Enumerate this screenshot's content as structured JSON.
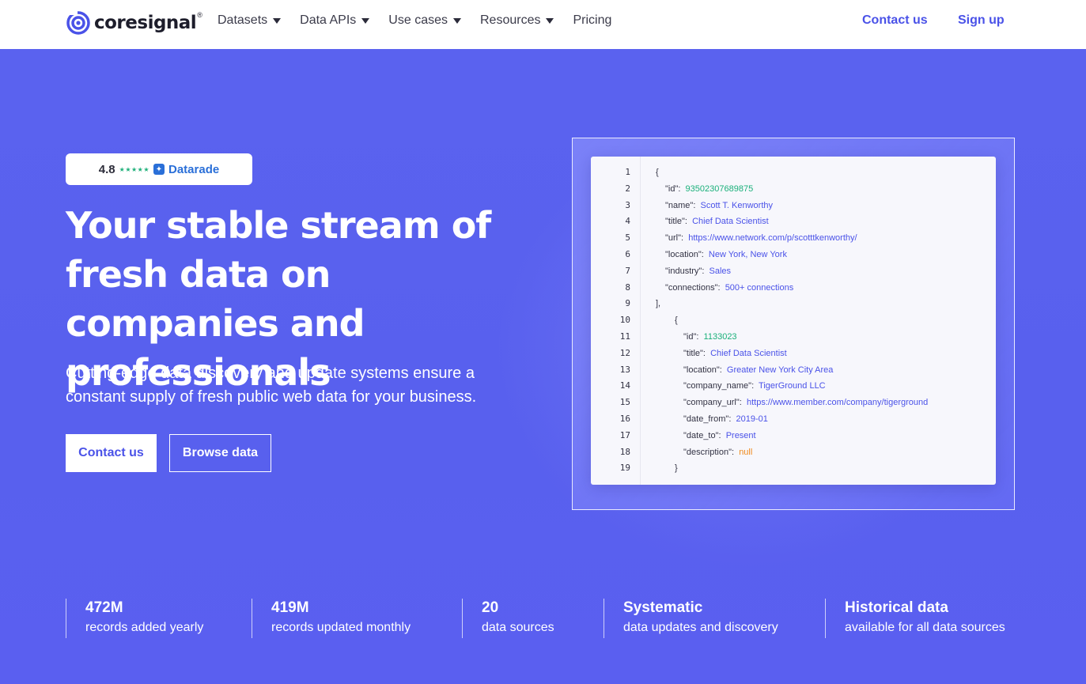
{
  "nav": {
    "brand": "coresignal",
    "brand_mark": "®",
    "menu": [
      {
        "label": "Datasets",
        "has_dropdown": true
      },
      {
        "label": "Data APIs",
        "has_dropdown": true
      },
      {
        "label": "Use cases",
        "has_dropdown": true
      },
      {
        "label": "Resources",
        "has_dropdown": true
      },
      {
        "label": "Pricing",
        "has_dropdown": false
      }
    ],
    "contact_label": "Contact us",
    "signup_label": "Sign up"
  },
  "hero": {
    "rating": {
      "score": "4.8",
      "stars": "★★★★★",
      "provider": "Datarade",
      "provider_icon": "datarade-icon"
    },
    "headline": "Your stable stream of fresh data on companies and professionals",
    "subtext": "Cutting-edge data discovery and update systems ensure a constant supply of fresh public web data for your business.",
    "primary_button": "Contact us",
    "secondary_button": "Browse data"
  },
  "code_sample": {
    "lines": [
      {
        "n": "1",
        "indent": 0,
        "text": "{"
      },
      {
        "n": "2",
        "indent": 1,
        "key": "\"id\":",
        "value": "93502307689875",
        "type": "num"
      },
      {
        "n": "3",
        "indent": 1,
        "key": "\"name\":",
        "value": "Scott T. Kenworthy",
        "type": "str"
      },
      {
        "n": "4",
        "indent": 1,
        "key": "\"title\":",
        "value": "Chief Data Scientist",
        "type": "str"
      },
      {
        "n": "5",
        "indent": 1,
        "key": "\"url\":",
        "value": "https://www.network.com/p/scotttkenworthy/",
        "type": "str"
      },
      {
        "n": "6",
        "indent": 1,
        "key": "\"location\":",
        "value": "New York, New York",
        "type": "str"
      },
      {
        "n": "7",
        "indent": 1,
        "key": "\"industry\":",
        "value": "Sales",
        "type": "str"
      },
      {
        "n": "8",
        "indent": 1,
        "key": "\"connections\":",
        "value": "500+ connections",
        "type": "str"
      },
      {
        "n": "9",
        "indent": 0,
        "text": "],"
      },
      {
        "n": "10",
        "indent": 2,
        "text": "{"
      },
      {
        "n": "11",
        "indent": 3,
        "key": "\"id\":",
        "value": "1133023",
        "type": "num"
      },
      {
        "n": "12",
        "indent": 3,
        "key": "\"title\":",
        "value": "Chief Data Scientist",
        "type": "str"
      },
      {
        "n": "13",
        "indent": 3,
        "key": "\"location\":",
        "value": "Greater New York City Area",
        "type": "str"
      },
      {
        "n": "14",
        "indent": 3,
        "key": "\"company_name\":",
        "value": "TigerGround LLC",
        "type": "str"
      },
      {
        "n": "15",
        "indent": 3,
        "key": "\"company_url\":",
        "value": "https://www.member.com/company/tigerground",
        "type": "str"
      },
      {
        "n": "16",
        "indent": 3,
        "key": "\"date_from\":",
        "value": "2019-01",
        "type": "str"
      },
      {
        "n": "17",
        "indent": 3,
        "key": "\"date_to\":",
        "value": "Present",
        "type": "str"
      },
      {
        "n": "18",
        "indent": 3,
        "key": "\"description\":",
        "value": "null",
        "type": "null"
      },
      {
        "n": "19",
        "indent": 2,
        "text": "}"
      }
    ]
  },
  "stats": [
    {
      "value": "472M",
      "label": "records added yearly"
    },
    {
      "value": "419M",
      "label": "records updated monthly"
    },
    {
      "value": "20",
      "label": "data sources"
    },
    {
      "value": "Systematic",
      "label": "data updates and discovery"
    },
    {
      "value": "Historical data",
      "label": "available for all data sources"
    }
  ],
  "colors": {
    "accent": "#4a52e8",
    "hero_bg": "#5a62ef",
    "json_number": "#1ab07a",
    "json_string": "#4a52e8",
    "json_null": "#f08a1c"
  }
}
